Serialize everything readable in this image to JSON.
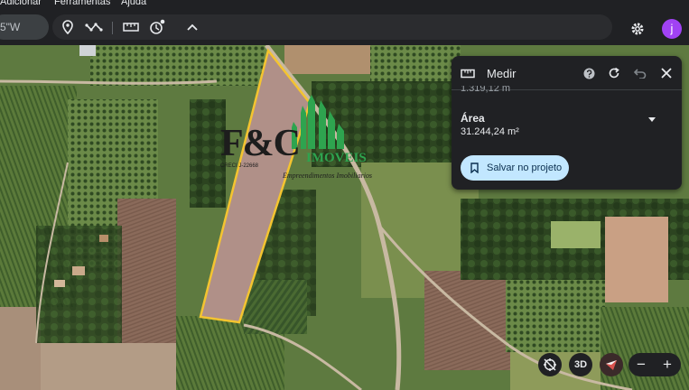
{
  "menu": {
    "items": [
      "Adicionar",
      "Ferramentas",
      "Ajuda"
    ]
  },
  "search": {
    "value": "5\"W"
  },
  "toolbar": {
    "icons": [
      "place-pin-icon",
      "path-icon",
      "ruler-icon",
      "tour-history-icon",
      "chevron-up-icon"
    ],
    "settings_icon": "gear-icon",
    "avatar_letter": "j"
  },
  "measure_panel": {
    "title": "Medir",
    "cut_value": "1.319,12 m",
    "area_label": "Área",
    "area_value": "31.244,24 m²",
    "save_label": "Salvar no projeto",
    "icons": [
      "ruler-icon",
      "help-icon",
      "refresh-icon",
      "undo-icon",
      "close-icon",
      "bookmark-icon",
      "dropdown-caret-icon"
    ]
  },
  "watermark": {
    "brand": "F&C",
    "brand_suffix": "IMOVEIS",
    "creci": "CRECI J-22668",
    "tagline": "Empreendimentos Imobiliarios"
  },
  "map_controls": {
    "compass_icon": "compass-off-icon",
    "view_3d_label": "3D",
    "zoom_out_label": "−",
    "zoom_in_label": "+"
  },
  "colors": {
    "ui_dark": "#202124",
    "accent_button": "#c2e7ff",
    "avatar": "#a142f4",
    "polygon_outline": "#f4c430",
    "logo_green": "#2ea44f"
  }
}
